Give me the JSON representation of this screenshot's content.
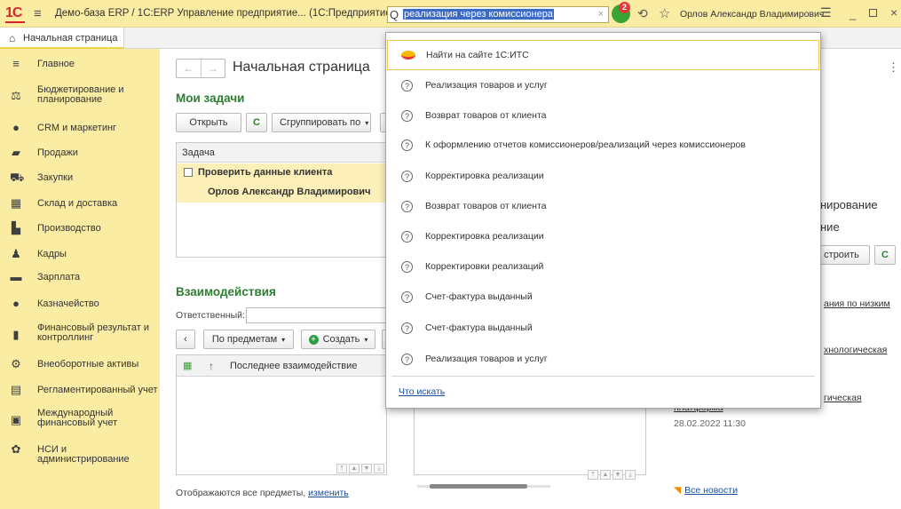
{
  "titlebar": {
    "logo": "1С",
    "title": "Демо-база ERP / 1С:ERP Управление предприятие... (1С:Предприятие)",
    "search_value": "реализация через комиссионера",
    "notification_count": "2",
    "user": "Орлов Александр Владимирович"
  },
  "tabs": {
    "home": "Начальная страница"
  },
  "sidebar": {
    "items": [
      {
        "label": "Главное",
        "icon": "menu-icon"
      },
      {
        "label": "Бюджетирование и планирование",
        "icon": "budget-icon"
      },
      {
        "label": "CRM и маркетинг",
        "icon": "crm-icon"
      },
      {
        "label": "Продажи",
        "icon": "sales-icon"
      },
      {
        "label": "Закупки",
        "icon": "cart-icon"
      },
      {
        "label": "Склад и доставка",
        "icon": "warehouse-icon"
      },
      {
        "label": "Производство",
        "icon": "factory-icon"
      },
      {
        "label": "Кадры",
        "icon": "person-icon"
      },
      {
        "label": "Зарплата",
        "icon": "salary-icon"
      },
      {
        "label": "Казначейство",
        "icon": "treasury-icon"
      },
      {
        "label": "Финансовый результат и контроллинг",
        "icon": "chart-icon"
      },
      {
        "label": "Внеоборотные активы",
        "icon": "assets-icon"
      },
      {
        "label": "Регламентированный учет",
        "icon": "document-icon"
      },
      {
        "label": "Международный финансовый учет",
        "icon": "intl-finance-icon"
      },
      {
        "label": "НСИ и администрирование",
        "icon": "gear-icon"
      }
    ]
  },
  "main": {
    "page_title": "Начальная страница",
    "tasks": {
      "title": "Мои задачи",
      "open_button": "Открыть",
      "group_button": "Сгруппировать по",
      "column": "Задача",
      "row_task": "Проверить данные клиента",
      "row_person": "Орлов Александр Владимирович"
    },
    "interactions": {
      "title": "Взаимодействия",
      "responsible_label": "Ответственный:",
      "by_subject": "По предметам",
      "create": "Создать",
      "column": "Последнее взаимодействие",
      "footer_text": "Отображаются все предметы,",
      "footer_link": "изменить"
    },
    "right": {
      "heading1": "нирование",
      "heading2": "ние",
      "customize": "строить",
      "link1": "ания по низким",
      "link2": "хнологическая",
      "link3": "гическая",
      "link4": "платформа",
      "date": "28.02.2022 11:30",
      "all_news": "Все новости"
    }
  },
  "popup": {
    "items": [
      {
        "label": "Найти на сайте 1С:ИТС"
      },
      {
        "label": "Реализация товаров и услуг"
      },
      {
        "label": "Возврат товаров от клиента"
      },
      {
        "label": "К оформлению отчетов комиссионеров/реализаций через комиссионеров"
      },
      {
        "label": "Корректировка реализации"
      },
      {
        "label": "Возврат товаров от клиента"
      },
      {
        "label": "Корректировка реализации"
      },
      {
        "label": "Корректировки реализаций"
      },
      {
        "label": "Счет-фактура выданный"
      },
      {
        "label": "Счет-фактура выданный"
      },
      {
        "label": "Реализация товаров и услуг"
      }
    ],
    "what_to_search": "Что искать"
  }
}
